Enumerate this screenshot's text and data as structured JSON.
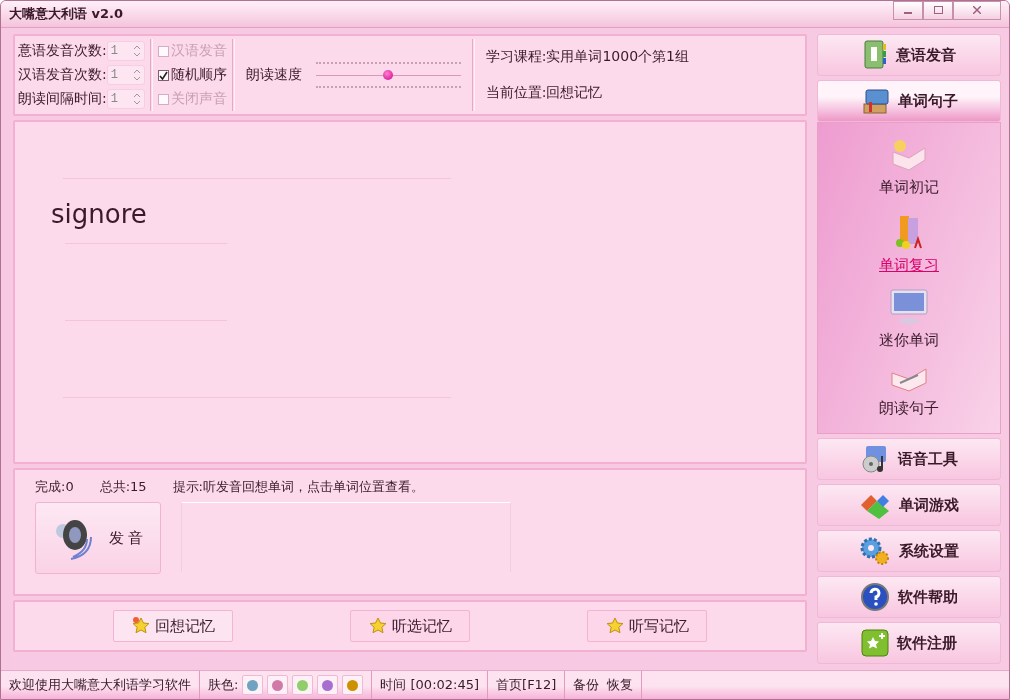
{
  "window": {
    "title": "大嘴意大利语 v2.0"
  },
  "settings": {
    "spinners": [
      {
        "label": "意语发音次数:",
        "value": "1"
      },
      {
        "label": "汉语发音次数:",
        "value": "1"
      },
      {
        "label": "朗读间隔时间:",
        "value": "1"
      }
    ],
    "checkboxes": [
      {
        "label": "汉语发音",
        "checked": false,
        "disabled": true
      },
      {
        "label": "随机顺序",
        "checked": true,
        "disabled": false
      },
      {
        "label": "关闭声音",
        "checked": false,
        "disabled": true
      }
    ],
    "speed": {
      "label": "朗读速度",
      "level": 0.5
    },
    "course": "学习课程:实用单词1000个第1组",
    "position": "当前位置:回想记忆"
  },
  "word": "signore",
  "info": {
    "done": "完成:0",
    "total": "总共:15",
    "hint": "提示:听发音回想单词，点击单词位置查看。",
    "speak_button": "发 音"
  },
  "modes": [
    {
      "label": "回想记忆",
      "selected": true
    },
    {
      "label": "听选记忆",
      "selected": false
    },
    {
      "label": "听写记忆",
      "selected": false
    }
  ],
  "sidebar": [
    {
      "label": "意语发音",
      "kind": "notebook",
      "expanded": false
    },
    {
      "label": "单词句子",
      "kind": "books",
      "expanded": true,
      "items": [
        {
          "label": "单词初记",
          "kind": "bulb-book",
          "selected": false
        },
        {
          "label": "单词复习",
          "kind": "abc-books",
          "selected": true
        },
        {
          "label": "迷你单词",
          "kind": "monitor",
          "selected": false
        },
        {
          "label": "朗读句子",
          "kind": "pen-book",
          "selected": false
        }
      ]
    },
    {
      "label": "语音工具",
      "kind": "disc",
      "expanded": false
    },
    {
      "label": "单词游戏",
      "kind": "blocks",
      "expanded": false
    },
    {
      "label": "系统设置",
      "kind": "gears",
      "expanded": false
    },
    {
      "label": "软件帮助",
      "kind": "help",
      "expanded": false
    },
    {
      "label": "软件注册",
      "kind": "register",
      "expanded": false
    }
  ],
  "status_bar": {
    "welcome": "欢迎使用大嘴意大利语学习软件",
    "skin_label": "肤色:",
    "skins": [
      {
        "color": "#6fa3bf"
      },
      {
        "color": "#d17aa8"
      },
      {
        "color": "#8fce6a"
      },
      {
        "color": "#a86fd0"
      },
      {
        "color": "#cc9000"
      }
    ],
    "time": "时间 [00:02:45]",
    "home": "首页[F12]",
    "backup": "备份",
    "restore": "恢复"
  }
}
